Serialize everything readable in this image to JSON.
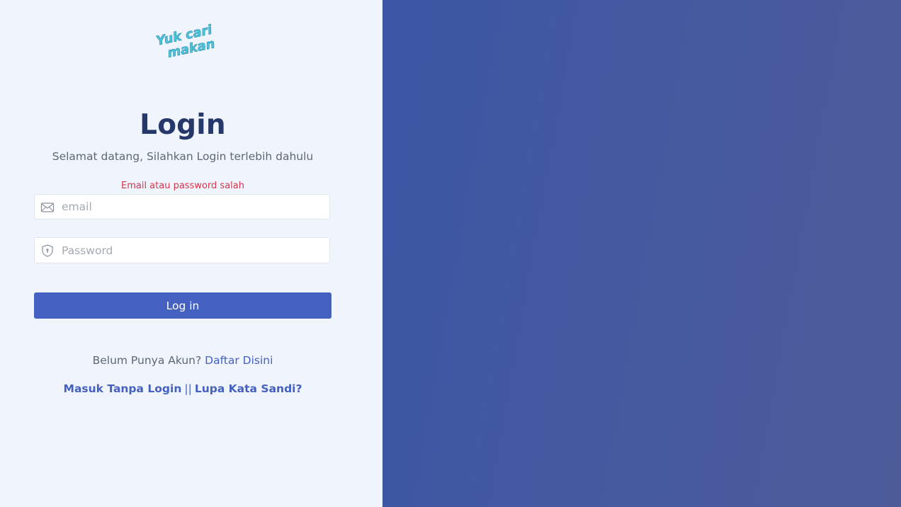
{
  "brand": {
    "logo_line1": "Yuk cari",
    "logo_line2": "makan",
    "logo_color": "#4fc3dd"
  },
  "login": {
    "title": "Login",
    "subtitle": "Selamat datang, Silahkan Login terlebih dahulu",
    "error": "Email atau password salah",
    "email_placeholder": "email",
    "password_placeholder": "Password",
    "submit_label": "Log in",
    "register_prompt": "Belum Punya Akun?",
    "register_link": "Daftar Disini",
    "guest_link": "Masuk Tanpa Login",
    "separator": "||",
    "forgot_link": "Lupa Kata Sandi?"
  },
  "icons": {
    "email": "envelope-icon",
    "password": "shield-icon"
  },
  "colors": {
    "accent": "#4460c1",
    "title": "#25376b",
    "error": "#d6354a",
    "left_bg": "#f0f5fd",
    "right_bg": "#3f57a3"
  }
}
